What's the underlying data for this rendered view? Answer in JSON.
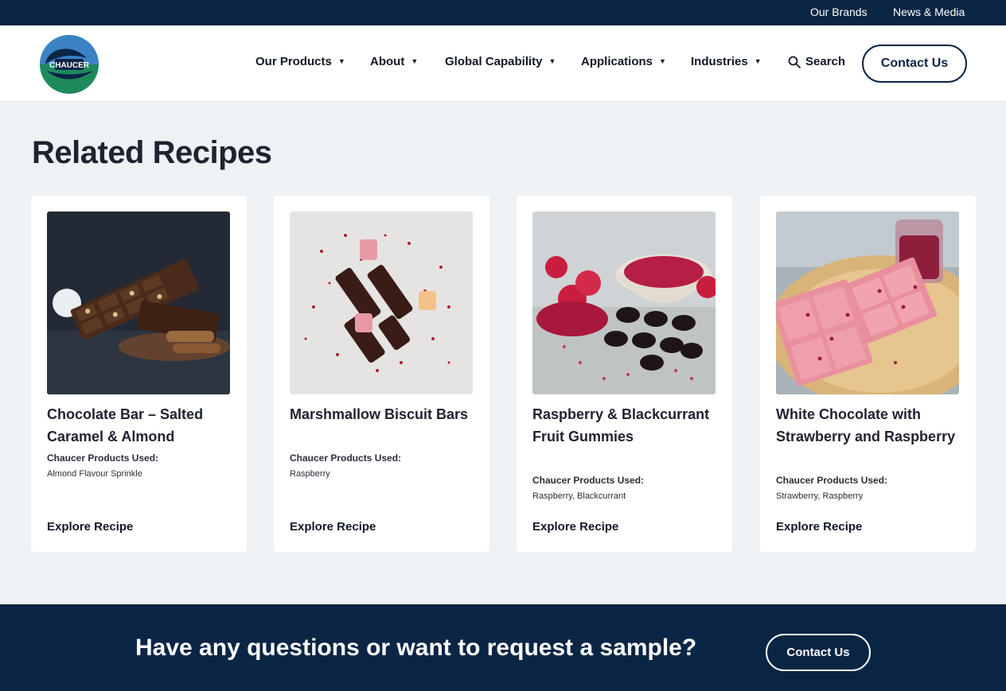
{
  "topbar": {
    "brands": "Our Brands",
    "news": "News & Media"
  },
  "header": {
    "logo_text": "CHAUCER",
    "nav": [
      "Our Products",
      "About",
      "Global Capability",
      "Applications",
      "Industries"
    ],
    "search": "Search",
    "contact": "Contact Us"
  },
  "section_title": "Related Recipes",
  "recipes": [
    {
      "title": "Chocolate Bar – Salted Caramel & Almond",
      "used_label": "Chaucer Products Used:",
      "used": "Almond Flavour Sprinkle",
      "explore": "Explore Recipe"
    },
    {
      "title": "Marshmallow Biscuit Bars",
      "used_label": "Chaucer Products Used:",
      "used": "Raspberry",
      "explore": "Explore Recipe"
    },
    {
      "title": "Raspberry & Blackcurrant Fruit Gummies",
      "used_label": "Chaucer Products Used:",
      "used": "Raspberry, Blackcurrant",
      "explore": "Explore Recipe"
    },
    {
      "title": "White Chocolate with Strawberry and Raspberry",
      "used_label": "Chaucer Products Used:",
      "used": "Strawberry, Raspberry",
      "explore": "Explore Recipe"
    }
  ],
  "cta": {
    "question": "Have any questions or want to request a sample?",
    "button": "Contact Us"
  },
  "colors": {
    "navy": "#0b2545",
    "page_bg": "#eef2f5",
    "logo_blue": "#1e6fb8",
    "logo_green": "#1e8a5c"
  }
}
